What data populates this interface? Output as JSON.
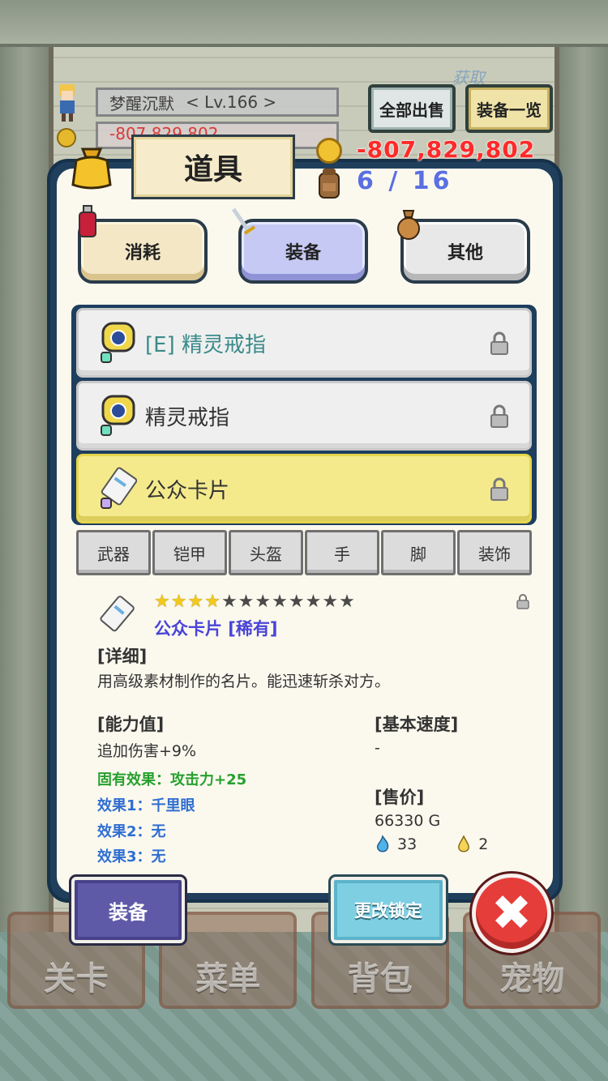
{
  "hud": {
    "player_name": "梦醒沉默",
    "level": "< Lv.166 >",
    "gold_faded": "-807,829,802"
  },
  "top_buttons": {
    "sell_all": "全部出售",
    "equip_list": "装备一览",
    "watermark": "获取"
  },
  "panel": {
    "title": "道具",
    "gold": "-807,829,802",
    "capacity": "6 / 16"
  },
  "categories": [
    {
      "label": "消耗",
      "active": false
    },
    {
      "label": "装备",
      "active": true
    },
    {
      "label": "其他",
      "active": false
    }
  ],
  "items": [
    {
      "label": "[E] 精灵戒指",
      "equipped": true,
      "selected": false
    },
    {
      "label": "精灵戒指",
      "equipped": false,
      "selected": false
    },
    {
      "label": "公众卡片",
      "equipped": false,
      "selected": true
    }
  ],
  "slots": [
    "武器",
    "铠甲",
    "头盔",
    "手",
    "脚",
    "装饰"
  ],
  "detail": {
    "stars_filled": 4,
    "stars_total": 12,
    "name": "公众卡片 [稀有]",
    "section_detail": "[详细]",
    "description": "用高级素材制作的名片。能迅速斩杀对方。",
    "section_ability": "[能力值]",
    "ability": "追加伤害+9%",
    "fixed_effect": "固有效果：攻击力+25",
    "effect1": "效果1：千里眼",
    "effect2": "效果2：无",
    "effect3": "效果3：无",
    "section_speed": "[基本速度]",
    "speed": "-",
    "section_price": "[售价]",
    "price": "66330 G",
    "blue_flame": "33",
    "yellow_drop": "2"
  },
  "actions": {
    "equip": "装备",
    "change_lock": "更改锁定",
    "close": "✖"
  },
  "bottom_nav": [
    "关卡",
    "菜单",
    "背包",
    "宠物"
  ],
  "colors": {
    "panel_border": "#1f3f5c",
    "selected_item": "#f4ea8c",
    "gold_text": "#ff2a2a",
    "rarity_text": "#4a44d8"
  }
}
